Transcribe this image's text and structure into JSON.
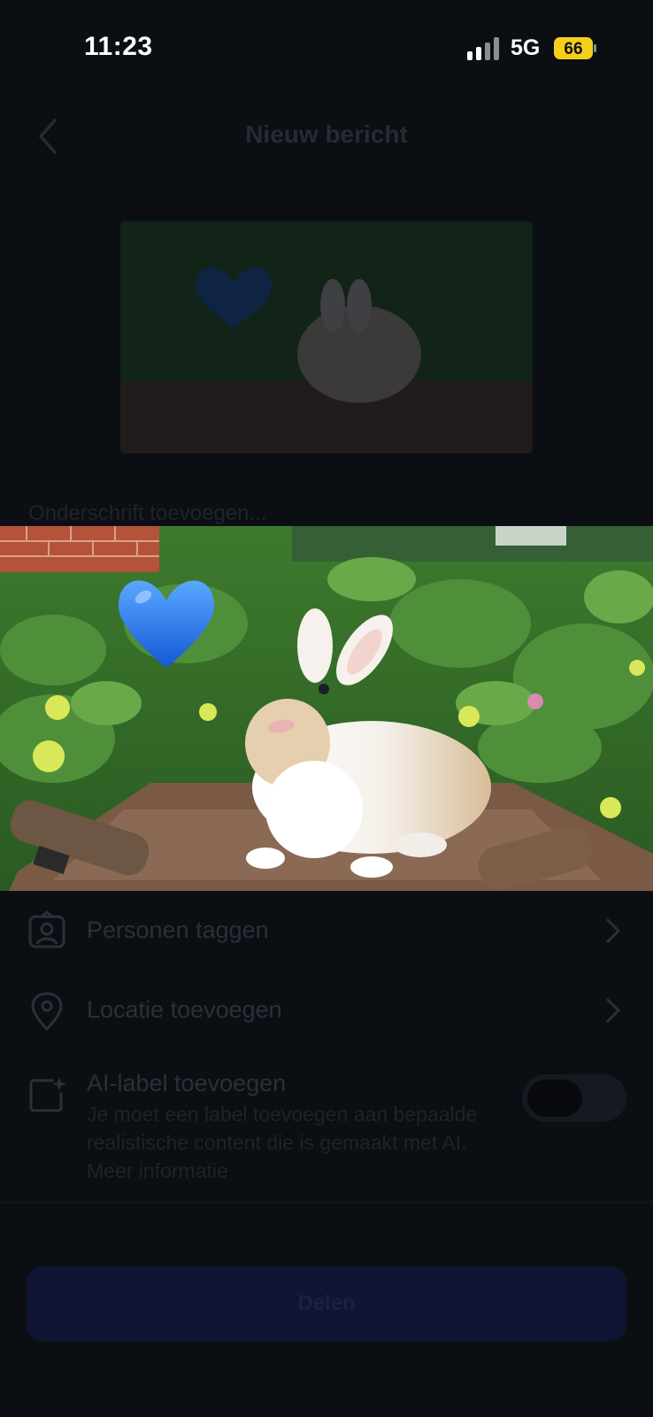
{
  "status": {
    "time": "11:23",
    "network": "5G",
    "battery": "66"
  },
  "header": {
    "title": "Nieuw bericht"
  },
  "caption": {
    "placeholder": "Onderschrift toevoegen..."
  },
  "options": [
    {
      "label": "Personen taggen",
      "icon": "person-tag-icon"
    },
    {
      "label": "Locatie toevoegen",
      "icon": "location-pin-icon"
    }
  ],
  "ai_label": {
    "title": "AI-label toevoegen",
    "description": "Je moet een label toevoegen aan bepaalde realistische content die is gemaakt met AI. Meer informatie",
    "toggle_on": false
  },
  "share_button": {
    "label": "Delen"
  },
  "colors": {
    "background": "#0b0f14",
    "heart": "#1f6fe6",
    "share_button": "#0f1532",
    "battery": "#f5cf1a"
  }
}
